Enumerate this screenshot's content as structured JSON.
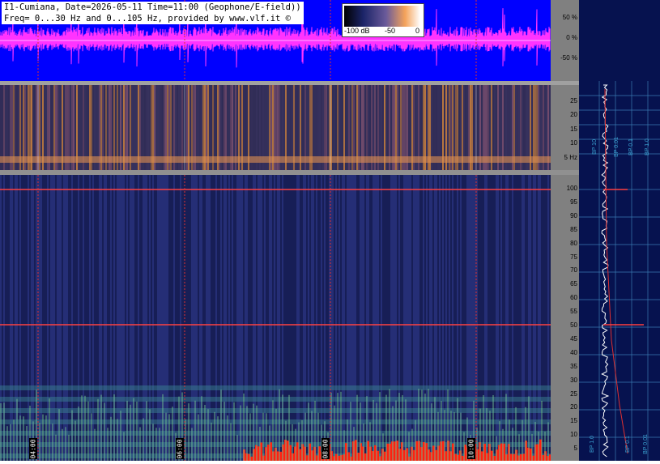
{
  "title": {
    "line1": "I1-Cumiana, Date=2026-05-11 Time=11:00 (Geophone/E-field))",
    "line2": "Freq= 0...30 Hz and 0...105 Hz, provided by www.vlf.it ©"
  },
  "colorbar": {
    "label_min": "-100 dB",
    "label_mid": "-50",
    "label_max": "0"
  },
  "wave_axis": [
    "50 %",
    "0 %",
    "-50 %"
  ],
  "low_axis": [
    "25",
    "20",
    "15",
    "10",
    "5 Hz"
  ],
  "high_axis": [
    "100",
    "95",
    "90",
    "85",
    "80",
    "75",
    "70",
    "65",
    "60",
    "55",
    "50",
    "45",
    "40",
    "35",
    "30",
    "25",
    "20",
    "15",
    "10",
    "5"
  ],
  "time_labels": [
    "04:00",
    "06:00",
    "08:00",
    "10:00"
  ],
  "bp_labels_low": [
    "BP 0.01",
    "BP 0.1",
    "BP 1.0",
    "BP 10",
    "BP 20."
  ],
  "bp_labels_high": [
    "BP 0.01",
    "BP 0.1",
    "BP 1.0",
    "BP 10.",
    "BP 20."
  ],
  "colors": {
    "wave_bg": "#0000ff",
    "wave_trace": "#ff33ff",
    "grid_red": "#e03030",
    "hum_line": "#ff4040",
    "panel_bg": "#06124f"
  }
}
